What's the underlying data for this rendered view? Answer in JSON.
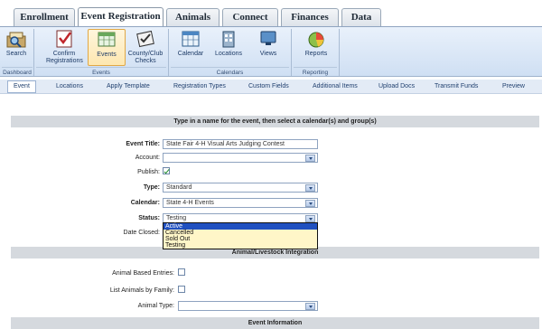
{
  "tabs": [
    "Enrollment",
    "Event Registration",
    "Animals",
    "Connect",
    "Finances",
    "Data"
  ],
  "ribbon": {
    "buttons": [
      "Search",
      "Confirm Registrations",
      "Events",
      "County/Club Checks",
      "Calendar",
      "Locations",
      "Views",
      "Reports"
    ],
    "groups": [
      "Dashboard",
      "Events",
      "Calendars",
      "Reporting"
    ]
  },
  "subnav": [
    "Event",
    "Locations",
    "Apply Template",
    "Registration Types",
    "Custom Fields",
    "Additional Items",
    "Upload Docs",
    "Transmit Funds",
    "Preview"
  ],
  "section1": {
    "title": "Type in a name for the event, then select a calendar(s) and group(s)"
  },
  "form": {
    "event_title_label": "Event Title:",
    "event_title_value": "State Fair 4-H Visual Arts Judging Contest",
    "account_label": "Account:",
    "account_value": "",
    "publish_label": "Publish:",
    "type_label": "Type:",
    "type_value": "Standard",
    "calendar_label": "Calendar:",
    "calendar_value": "State 4-H Events",
    "status_label": "Status:",
    "status_value": "Testing",
    "date_closed_label": "Date Closed:"
  },
  "status_options": [
    "Active",
    "Cancelled",
    "Sold Out",
    "Testing"
  ],
  "section2": {
    "title": "Animal/Livestock Integration"
  },
  "animal": {
    "based_label": "Animal Based Entries:",
    "family_label": "List Animals by Family:",
    "type_label": "Animal Type:",
    "type_value": ""
  },
  "section3": {
    "title": "Event Information"
  }
}
